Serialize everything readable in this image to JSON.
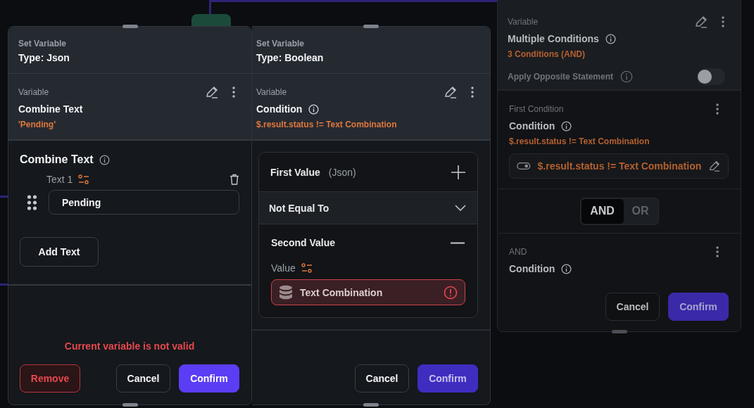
{
  "json_panel": {
    "header": {
      "label": "Set Variable",
      "type": "Type: Json"
    },
    "variable": {
      "label": "Variable",
      "name": "Combine Text",
      "value": "'Pending'"
    },
    "combine": {
      "title": "Combine Text",
      "texts": [
        {
          "label": "Text 1",
          "value": "Pending"
        }
      ],
      "add_button": "Add Text"
    },
    "error": "Current variable is not valid",
    "buttons": [
      {
        "label": "Remove",
        "kind": "danger",
        "disabled": false
      },
      {
        "label": "Cancel",
        "kind": "secondary",
        "disabled": false
      },
      {
        "label": "Confirm",
        "kind": "primary",
        "disabled": false
      }
    ]
  },
  "boolean_panel": {
    "header": {
      "label": "Set Variable",
      "type": "Type: Boolean"
    },
    "variable": {
      "label": "Variable",
      "name": "Condition",
      "value": "$.result.status  !=  Text Combination"
    },
    "first_value": {
      "title": "First Value",
      "type": "(Json)",
      "expanded": false
    },
    "operator": {
      "value": "Not Equal To"
    },
    "second_value": {
      "title": "Second Value",
      "expanded": true,
      "label": "Value",
      "field": "Text Combination",
      "invalid": true
    },
    "buttons": [
      {
        "label": "Cancel",
        "kind": "secondary",
        "disabled": false
      },
      {
        "label": "Confirm",
        "kind": "primary",
        "disabled": true
      }
    ]
  },
  "conditions_panel": {
    "variable": {
      "label": "Variable",
      "name": "Multiple Conditions",
      "value": "3 Conditions (AND)"
    },
    "opposite": {
      "label": "Apply Opposite Statement",
      "on": false
    },
    "conditions": [
      {
        "label": "First Condition",
        "name": "Condition",
        "expression": "$.result.status  !=  Text Combination",
        "chip": "$.result.status  !=  Text Combination"
      }
    ],
    "joiner": [
      {
        "label": "AND",
        "selected": true
      },
      {
        "label": "OR",
        "selected": false
      }
    ],
    "second": {
      "label": "AND",
      "name": "Condition"
    },
    "buttons": [
      {
        "label": "Cancel",
        "kind": "secondary",
        "disabled": false
      },
      {
        "label": "Confirm",
        "kind": "primary",
        "disabled": true
      }
    ]
  }
}
